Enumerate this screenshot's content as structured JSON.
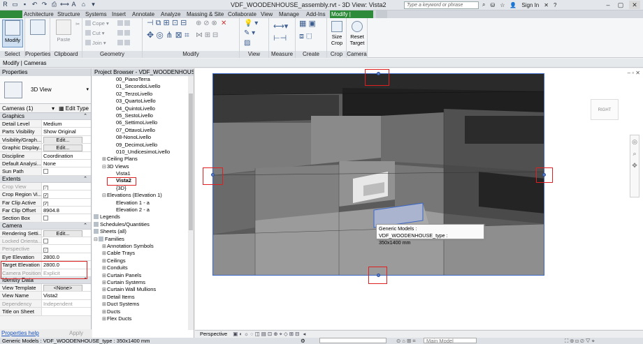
{
  "app": {
    "window_title": "VDF_WOODENHOUSE_assembly.rvt - 3D View: Vista2",
    "search_placeholder": "Type a keyword or phrase",
    "sign_in": "Sign In",
    "help": "?"
  },
  "tabs": [
    "Architecture",
    "Structure",
    "Systems",
    "Insert",
    "Annotate",
    "Analyze",
    "Massing & Site",
    "Collaborate",
    "View",
    "Manage",
    "Add-Ins",
    "Modify | Cameras"
  ],
  "ribbon": {
    "modify": "Modify",
    "paste": "Paste",
    "cope": "Cope",
    "cut": "Cut",
    "join": "Join",
    "size_crop": "Size Crop",
    "reset_target": "Reset Target",
    "panels": [
      "Select",
      "Properties",
      "Clipboard",
      "Geometry",
      "Modify",
      "View",
      "Measure",
      "Create",
      "Crop",
      "Camera"
    ]
  },
  "context_bar": "Modify | Cameras",
  "properties": {
    "title": "Properties",
    "type_name": "3D View",
    "selector": "Cameras (1)",
    "edit_type": "Edit Type",
    "groups": {
      "graphics": "Graphics",
      "extents": "Extents",
      "camera": "Camera",
      "identity": "Identity Data"
    },
    "rows": {
      "detail_level": [
        "Detail Level",
        "Medium"
      ],
      "parts_visibility": [
        "Parts Visibility",
        "Show Original"
      ],
      "vis_graph": [
        "Visibility/Graph...",
        "Edit..."
      ],
      "graphic_display": [
        "Graphic Display...",
        "Edit..."
      ],
      "discipline": [
        "Discipline",
        "Coordination"
      ],
      "default_analysis": [
        "Default Analysi...",
        "None"
      ],
      "sun_path": [
        "Sun Path",
        ""
      ],
      "crop_view": [
        "Crop View",
        ""
      ],
      "crop_region": [
        "Crop Region Vi...",
        ""
      ],
      "far_clip_active": [
        "Far Clip Active",
        ""
      ],
      "far_clip_offset": [
        "Far Clip Offset",
        "8904.8"
      ],
      "section_box": [
        "Section Box",
        ""
      ],
      "rendering": [
        "Rendering Setti...",
        "Edit..."
      ],
      "locked_orient": [
        "Locked Orienta...",
        ""
      ],
      "perspective": [
        "Perspective",
        ""
      ],
      "eye_elevation": [
        "Eye Elevation",
        "2800.0"
      ],
      "target_elevation": [
        "Target Elevation",
        "2800.0"
      ],
      "camera_position": [
        "Camera Position",
        "Explicit"
      ],
      "view_template": [
        "View Template",
        "<None>"
      ],
      "view_name": [
        "View Name",
        "Vista2"
      ],
      "dependency": [
        "Dependency",
        "Independent"
      ],
      "title_on_sheet": [
        "Title on Sheet",
        ""
      ]
    },
    "help": "Properties help",
    "apply": "Apply"
  },
  "browser": {
    "title": "Project Browser - VDF_WOODENHOUSE_a...",
    "levels": [
      "00_PianoTerra",
      "01_SecondoLivello",
      "02_TerzoLivello",
      "03_QuartoLivello",
      "04_QuintoLivello",
      "05_SestoLivello",
      "06_SettimoLivello",
      "07_OttavoLivello",
      "08-NonoLivello",
      "09_DecimoLivello",
      "010_UndicesimoLivello"
    ],
    "ceiling_plans": "Ceiling Plans",
    "views_3d": "3D Views",
    "views_3d_items": [
      "Vista1",
      "Vista2",
      "{3D}"
    ],
    "elevations": "Elevations (Elevation 1)",
    "elevation_items": [
      "Elevation 1 - a",
      "Elevation 2 - a"
    ],
    "legends": "Legends",
    "schedules": "Schedules/Quantities",
    "sheets": "Sheets (all)",
    "families": "Families",
    "family_items": [
      "Annotation Symbols",
      "Cable Trays",
      "Ceilings",
      "Conduits",
      "Curtain Panels",
      "Curtain Systems",
      "Curtain Wall Mullions",
      "Detail Items",
      "Duct Systems",
      "Ducts",
      "Flex Ducts"
    ]
  },
  "viewport": {
    "tooltip_line1": "Generic Models : VDF_WOODENHOUSE_type :",
    "tooltip_line2": "350x1400 mm",
    "navcube_label": "RIGHT",
    "view_mode": "Perspective"
  },
  "status": {
    "left": "Generic Models : VDF_WOODENHOUSE_type : 350x1400 mm",
    "model": "Main Model"
  }
}
